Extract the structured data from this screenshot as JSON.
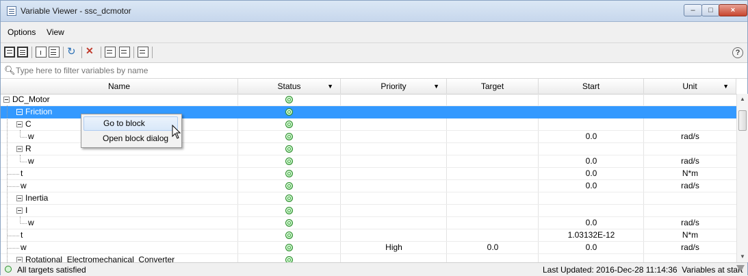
{
  "window": {
    "title": "Variable Viewer - ssc_dcmotor",
    "minimize": "–",
    "maximize": "□",
    "close": "×"
  },
  "menu": {
    "options": "Options",
    "view": "View"
  },
  "toolbar": {
    "help": "?"
  },
  "filter": {
    "placeholder": "Type here to filter variables by name"
  },
  "columns": {
    "name": "Name",
    "status": "Status",
    "priority": "Priority",
    "target": "Target",
    "start": "Start",
    "unit": "Unit"
  },
  "rows": [
    {
      "name": "DC_Motor",
      "status": "ok",
      "priority": "",
      "target": "",
      "start": "",
      "unit": ""
    },
    {
      "name": "Friction",
      "status": "ok",
      "priority": "",
      "target": "",
      "start": "",
      "unit": ""
    },
    {
      "name": "C",
      "status": "ok",
      "priority": "",
      "target": "",
      "start": "",
      "unit": ""
    },
    {
      "name": "w",
      "status": "ok",
      "priority": "",
      "target": "",
      "start": "0.0",
      "unit": "rad/s"
    },
    {
      "name": "R",
      "status": "ok",
      "priority": "",
      "target": "",
      "start": "",
      "unit": ""
    },
    {
      "name": "w",
      "status": "ok",
      "priority": "",
      "target": "",
      "start": "0.0",
      "unit": "rad/s"
    },
    {
      "name": "t",
      "status": "ok",
      "priority": "",
      "target": "",
      "start": "0.0",
      "unit": "N*m"
    },
    {
      "name": "w",
      "status": "ok",
      "priority": "",
      "target": "",
      "start": "0.0",
      "unit": "rad/s"
    },
    {
      "name": "Inertia",
      "status": "ok",
      "priority": "",
      "target": "",
      "start": "",
      "unit": ""
    },
    {
      "name": "I",
      "status": "ok",
      "priority": "",
      "target": "",
      "start": "",
      "unit": ""
    },
    {
      "name": "w",
      "status": "ok",
      "priority": "",
      "target": "",
      "start": "0.0",
      "unit": "rad/s"
    },
    {
      "name": "t",
      "status": "ok",
      "priority": "",
      "target": "",
      "start": "1.03132E-12",
      "unit": "N*m"
    },
    {
      "name": "w",
      "status": "ok",
      "priority": "High",
      "target": "0.0",
      "start": "0.0",
      "unit": "rad/s"
    },
    {
      "name": "Rotational_Electromechanical_Converter",
      "status": "ok",
      "priority": "",
      "target": "",
      "start": "",
      "unit": ""
    }
  ],
  "context_menu": {
    "go_to_block": "Go to block",
    "open_block_dialog": "Open block dialog"
  },
  "statusbar": {
    "left": "All targets satisfied",
    "last_updated": "Last Updated: 2016-Dec-28 11:14:36",
    "mode": "Variables at start"
  },
  "colors": {
    "selection": "#3399ff",
    "status_ok": "#2c8a2c"
  }
}
